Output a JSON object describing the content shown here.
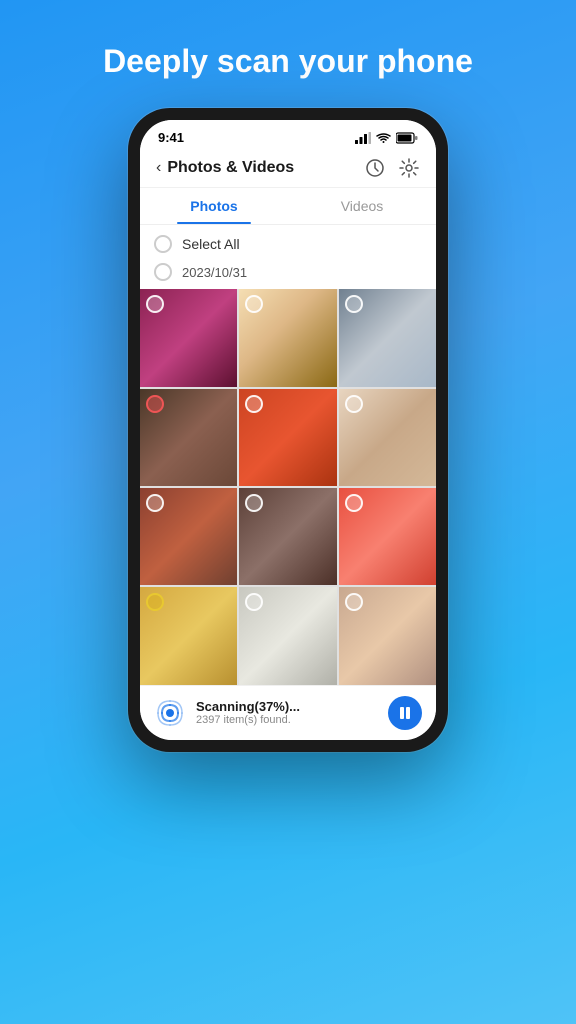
{
  "page": {
    "title": "Deeply scan your phone"
  },
  "statusBar": {
    "time": "9:41"
  },
  "navBar": {
    "back_label": "‹",
    "title": "Photos & Videos"
  },
  "tabs": [
    {
      "id": "photos",
      "label": "Photos",
      "active": true
    },
    {
      "id": "videos",
      "label": "Videos",
      "active": false
    }
  ],
  "selectAll": {
    "label": "Select All"
  },
  "dateGroup": {
    "label": "2023/10/31"
  },
  "photos": [
    {
      "id": 1,
      "colorClass": "p1",
      "selected": false
    },
    {
      "id": 2,
      "colorClass": "p2",
      "selected": false
    },
    {
      "id": 3,
      "colorClass": "p3",
      "selected": false
    },
    {
      "id": 4,
      "colorClass": "p4",
      "selected": false
    },
    {
      "id": 5,
      "colorClass": "p5",
      "selected": false
    },
    {
      "id": 6,
      "colorClass": "p6",
      "selected": false
    },
    {
      "id": 7,
      "colorClass": "p7",
      "selected": false
    },
    {
      "id": 8,
      "colorClass": "p8",
      "selected": false
    },
    {
      "id": 9,
      "colorClass": "p9",
      "selected": false
    },
    {
      "id": 10,
      "colorClass": "p10",
      "selected": false
    },
    {
      "id": 11,
      "colorClass": "p11",
      "selected": false
    },
    {
      "id": 12,
      "colorClass": "p12",
      "selected": false
    }
  ],
  "scanBar": {
    "status": "Scanning(37%)...",
    "count": "2397 item(s) found."
  }
}
